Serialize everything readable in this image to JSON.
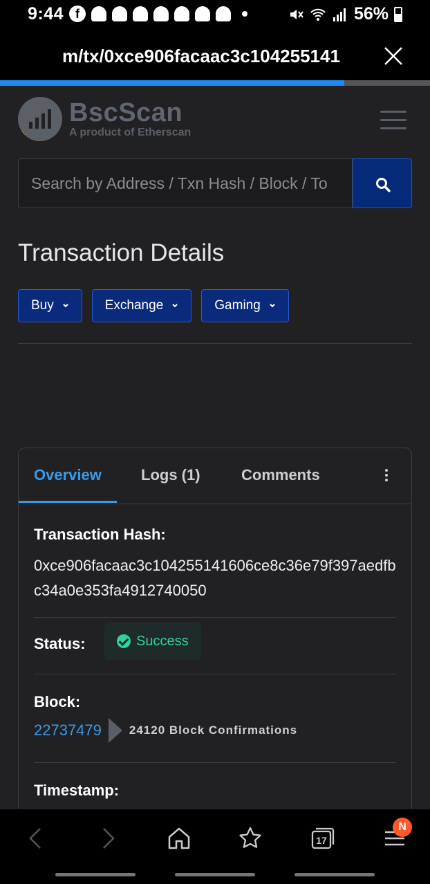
{
  "status_bar": {
    "time": "9:44",
    "battery": "56%"
  },
  "browser": {
    "url": "m/tx/0xce906facaac3c104255141",
    "load_progress": 0.8
  },
  "site": {
    "brand": "BscScan",
    "tagline": "A product of Etherscan"
  },
  "search": {
    "placeholder": "Search by Address / Txn Hash / Block / To"
  },
  "page_title": "Transaction Details",
  "menus": [
    "Buy",
    "Exchange",
    "Gaming"
  ],
  "tabs": {
    "overview": "Overview",
    "logs": "Logs (1)",
    "comments": "Comments"
  },
  "details": {
    "hash_label": "Transaction Hash:",
    "hash_value": "0xce906facaac3c104255141606ce8c36e79f397aedfbc34a0e353fa4912740050",
    "status_label": "Status:",
    "status_value": "Success",
    "block_label": "Block:",
    "block_value": "22737479",
    "confirmations": "24120 Block Confirmations",
    "timestamp_label": "Timestamp:"
  },
  "bottom_nav": {
    "tabs_count": "17",
    "menu_badge": "N"
  },
  "colors": {
    "accent": "#3a9ae6",
    "success": "#2fd29b",
    "primary_button": "#052a7a"
  }
}
